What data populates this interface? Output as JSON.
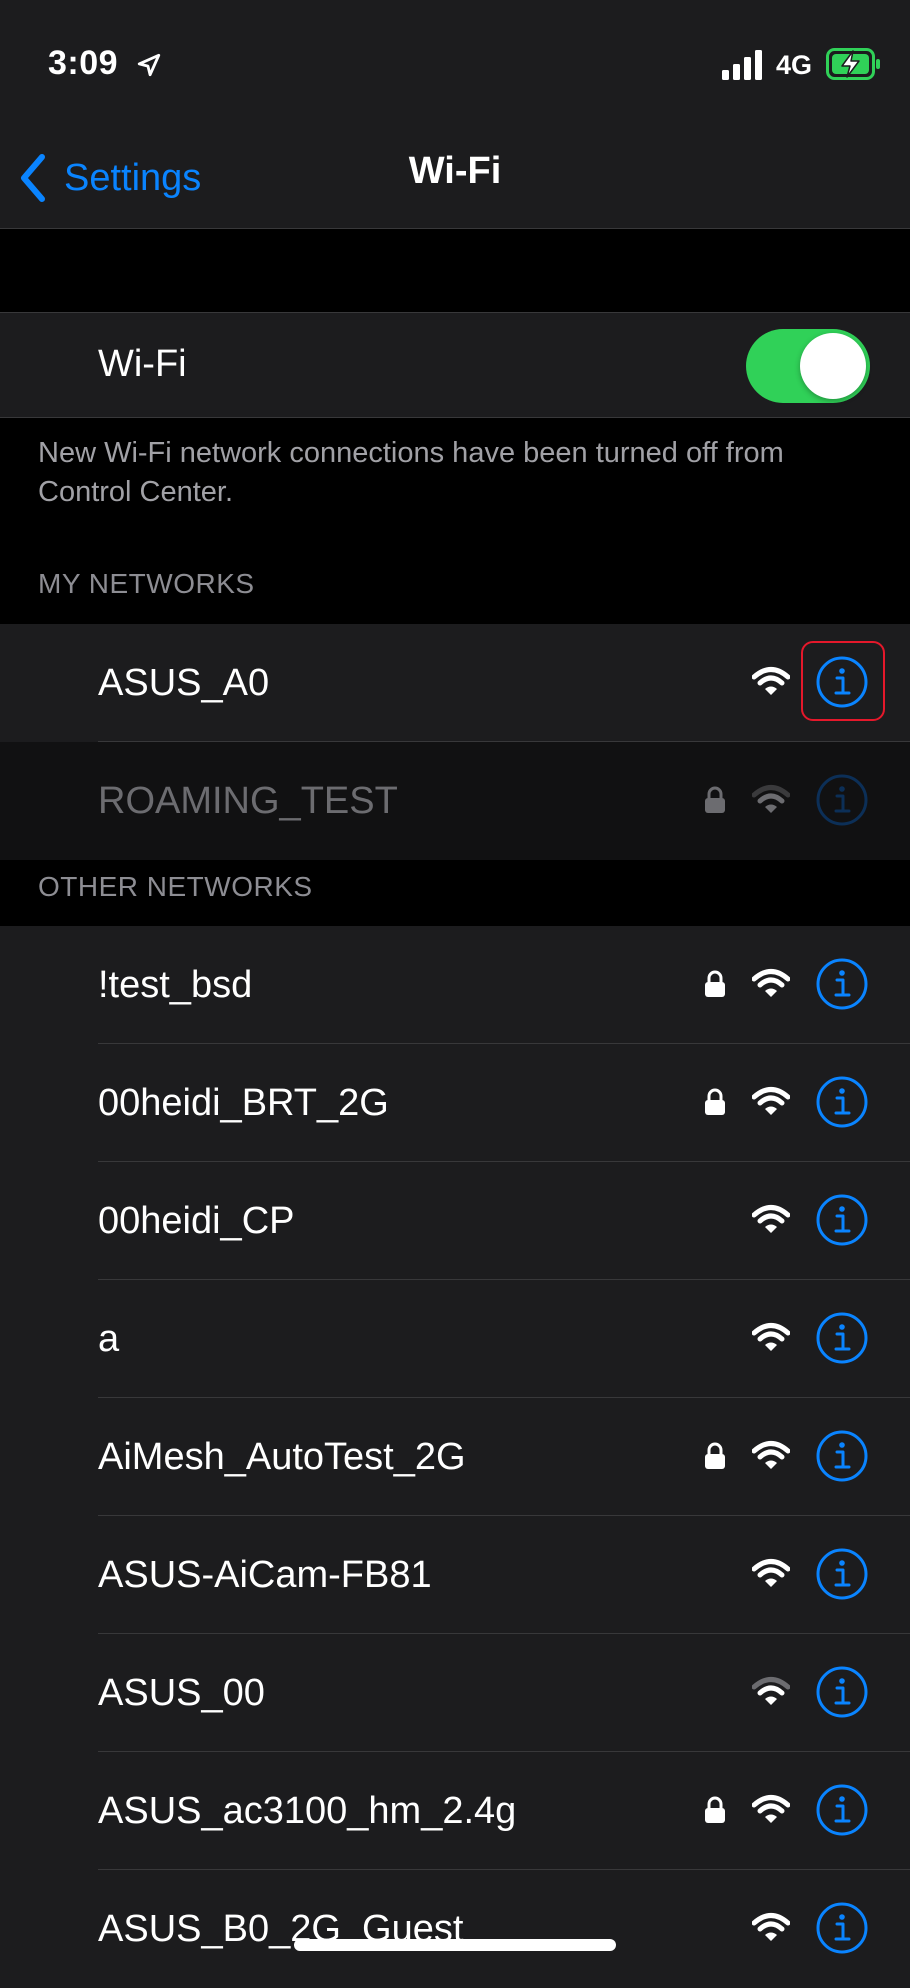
{
  "status_bar": {
    "time": "3:09",
    "network": "4G",
    "icons": [
      "location-arrow-icon",
      "cellular-signal-icon",
      "battery-charging-icon"
    ]
  },
  "nav": {
    "back_label": "Settings",
    "title": "Wi-Fi"
  },
  "wifi_toggle": {
    "label": "Wi-Fi",
    "on": true
  },
  "notice": "New Wi-Fi network connections have been turned off from Control Center.",
  "my_networks": {
    "header": "MY NETWORKS",
    "items": [
      {
        "name": "ASUS_A0",
        "locked": false,
        "signal": 3,
        "dimmed": false,
        "highlighted": true
      },
      {
        "name": "ROAMING_TEST",
        "locked": true,
        "signal": 2,
        "dimmed": true,
        "highlighted": false
      }
    ]
  },
  "other_networks": {
    "header": "OTHER NETWORKS",
    "items": [
      {
        "name": "!test_bsd",
        "locked": true,
        "signal": 3
      },
      {
        "name": "00heidi_BRT_2G",
        "locked": true,
        "signal": 3
      },
      {
        "name": "00heidi_CP",
        "locked": false,
        "signal": 3
      },
      {
        "name": "a",
        "locked": false,
        "signal": 3
      },
      {
        "name": "AiMesh_AutoTest_2G",
        "locked": true,
        "signal": 3
      },
      {
        "name": "ASUS-AiCam-FB81",
        "locked": false,
        "signal": 3
      },
      {
        "name": "ASUS_00",
        "locked": false,
        "signal": 2
      },
      {
        "name": "ASUS_ac3100_hm_2.4g",
        "locked": true,
        "signal": 3
      },
      {
        "name": "ASUS_B0_2G_Guest",
        "locked": false,
        "signal": 3
      }
    ]
  },
  "colors": {
    "accent": "#0a84ff",
    "toggle_on": "#30d158",
    "highlight": "#e5182b",
    "battery_charge": "#30d158"
  }
}
